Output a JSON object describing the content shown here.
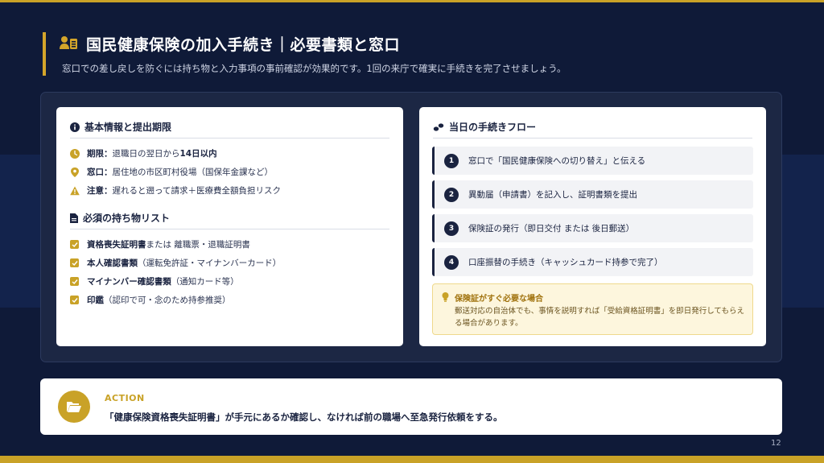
{
  "header": {
    "title": "国民健康保険の加入手続き｜必要書類と窓口",
    "subtitle": "窓口での差し戻しを防ぐには持ち物と入力事項の事前確認が効果的です。1回の来庁で確実に手続きを完了させましょう。"
  },
  "left_card": {
    "basic_heading": "基本情報と提出期限",
    "info": [
      {
        "icon": "clock-icon",
        "label": "期限：",
        "value_pre": "退職日の翌日から",
        "value_bold": "14日以内"
      },
      {
        "icon": "location-pin-icon",
        "label": "窓口：",
        "value_pre": "居住地の市区町村役場（国保年金課など）",
        "value_bold": ""
      },
      {
        "icon": "warning-icon",
        "label": "注意：",
        "value_pre": "遅れると遡って請求＋医療費全額負担リスク",
        "value_bold": ""
      }
    ],
    "items_heading": "必須の持ち物リスト",
    "items": [
      {
        "bold": "資格喪失証明書",
        "rest": " または 離職票・退職証明書"
      },
      {
        "bold": "本人確認書類",
        "rest": "（運転免許証・マイナンバーカード）"
      },
      {
        "bold": "マイナンバー確認書類",
        "rest": "（通知カード等）"
      },
      {
        "bold": "印鑑",
        "rest": "（認印で可・念のため持参推奨）"
      }
    ]
  },
  "right_card": {
    "heading": "当日の手続きフロー",
    "steps": [
      {
        "num": "1",
        "text": "窓口で「国民健康保険への切り替え」と伝える"
      },
      {
        "num": "2",
        "text": "異動届（申請書）を記入し、証明書類を提出"
      },
      {
        "num": "3",
        "text": "保険証の発行（即日交付 または 後日郵送）"
      },
      {
        "num": "4",
        "text": "口座振替の手続き（キャッシュカード持参で完了）"
      }
    ],
    "tip_title": "保険証がすぐ必要な場合",
    "tip_body": "郵送対応の自治体でも、事情を説明すれば「受給資格証明書」を即日発行してもらえる場合があります。"
  },
  "action": {
    "label": "ACTION",
    "text": "「健康保険資格喪失証明書」が手元にあるか確認し、なければ前の職場へ至急発行依頼をする。"
  },
  "page_number": "12",
  "colors": {
    "navy": "#0f1a38",
    "gold": "#c9a227",
    "card": "#ffffff"
  }
}
